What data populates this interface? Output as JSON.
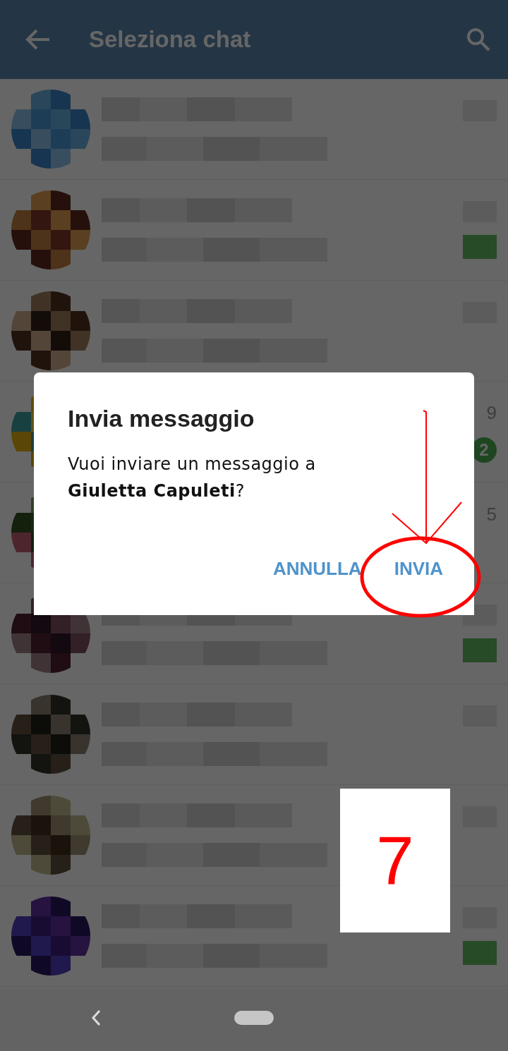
{
  "app_bar": {
    "title": "Seleziona chat"
  },
  "chats": [
    {
      "kind": "blurred"
    },
    {
      "kind": "blurred",
      "badge_blurred": true
    },
    {
      "kind": "blurred"
    },
    {
      "kind": "blurred",
      "time": "9",
      "badge": "2"
    },
    {
      "kind": "blurred",
      "time": "5"
    },
    {
      "kind": "blurred",
      "badge_blurred": true
    },
    {
      "kind": "blurred"
    },
    {
      "kind": "blurred"
    },
    {
      "kind": "blurred",
      "badge_blurred": true
    }
  ],
  "dialog": {
    "title": "Invia messaggio",
    "message": "Vuoi inviare un messaggio a **Giuletta Capuleti**?",
    "buttons": [
      "ANNULLA",
      "INVIA"
    ]
  },
  "annotation": {
    "step": "7"
  }
}
